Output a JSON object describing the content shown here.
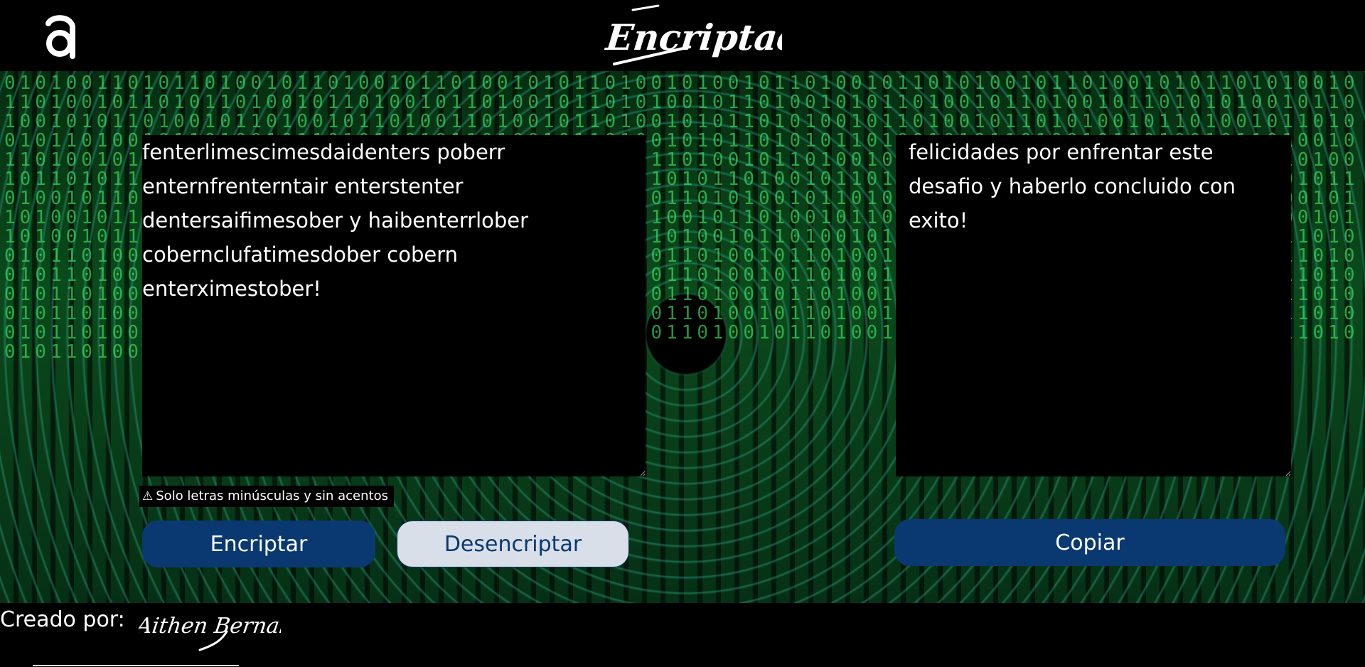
{
  "header": {
    "logo_icon": "alura-a-logo-icon",
    "title": "Encriptador"
  },
  "main": {
    "input_text": "fenterlimescimesdaidenters poberr enternfrenterntair enterstenter dentersaifimesober y haibenterrlober cobernclufatimesdober cobern enterximestober!",
    "output_text": "felicidades por enfrentar este desafio y haberlo concluido con exito!",
    "warning_icon": "warning-triangle-icon",
    "warning_text": "Solo letras minúsculas y sin acentos",
    "encrypt_label": "Encriptar",
    "decrypt_label": "Desencriptar",
    "copy_label": "Copiar"
  },
  "footer": {
    "label": "Creado por:",
    "author_signature": "Aithen Bernal"
  },
  "colors": {
    "page_background": "#000000",
    "primary_button": "#0a3871",
    "secondary_button": "#d8dfe8",
    "matrix_green": "#3ce664"
  }
}
